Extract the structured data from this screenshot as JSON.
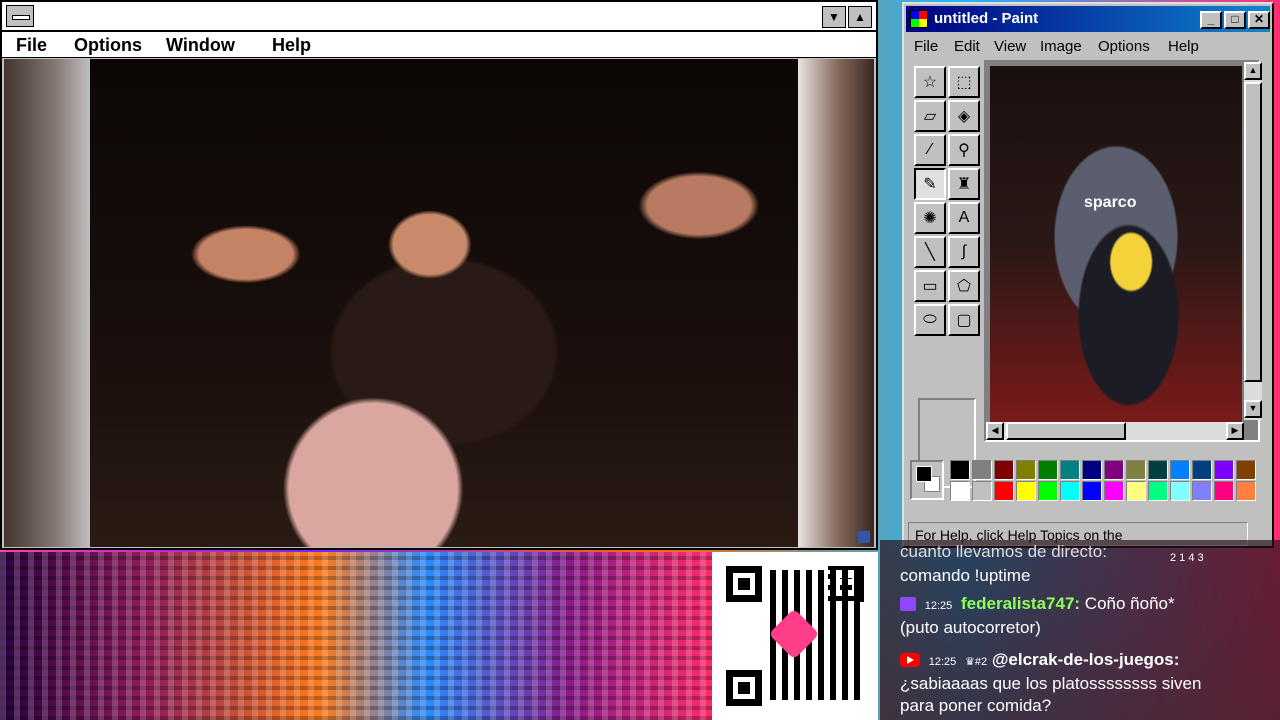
{
  "viewer": {
    "menu": [
      "File",
      "Options",
      "Window",
      "Help"
    ],
    "min_arrow": "▼",
    "max_arrow": "▲"
  },
  "paint": {
    "title": "untitled - Paint",
    "menu": [
      "File",
      "Edit",
      "View",
      "Image",
      "Options",
      "Help"
    ],
    "chair_label": "sparco",
    "status": "For Help, click Help Topics on the",
    "tools": [
      {
        "name": "free-select-icon",
        "glyph": "☆"
      },
      {
        "name": "rect-select-icon",
        "glyph": "⬚"
      },
      {
        "name": "eraser-icon",
        "glyph": "▱"
      },
      {
        "name": "fill-bucket-icon",
        "glyph": "◈"
      },
      {
        "name": "color-picker-icon",
        "glyph": "⁄"
      },
      {
        "name": "magnifier-icon",
        "glyph": "⚲"
      },
      {
        "name": "pencil-icon",
        "glyph": "✎"
      },
      {
        "name": "brush-icon",
        "glyph": "♜"
      },
      {
        "name": "airbrush-icon",
        "glyph": "✺"
      },
      {
        "name": "text-icon",
        "glyph": "A"
      },
      {
        "name": "line-icon",
        "glyph": "╲"
      },
      {
        "name": "curve-icon",
        "glyph": "∫"
      },
      {
        "name": "rectangle-icon",
        "glyph": "▭"
      },
      {
        "name": "polygon-icon",
        "glyph": "⬠"
      },
      {
        "name": "ellipse-icon",
        "glyph": "⬭"
      },
      {
        "name": "rounded-rect-icon",
        "glyph": "▢"
      }
    ],
    "palette_top": [
      "#000000",
      "#808080",
      "#800000",
      "#808000",
      "#008000",
      "#008080",
      "#000080",
      "#800080",
      "#808040",
      "#004040",
      "#0080ff",
      "#004080",
      "#8000ff",
      "#804000"
    ],
    "palette_bottom": [
      "#ffffff",
      "#c0c0c0",
      "#ff0000",
      "#ffff00",
      "#00ff00",
      "#00ffff",
      "#0000ff",
      "#ff00ff",
      "#ffff80",
      "#00ff80",
      "#80ffff",
      "#8080ff",
      "#ff0080",
      "#ff8040"
    ]
  },
  "chat": {
    "line1": "cuanto llevamos de directo:",
    "counts": "2  1  4  3",
    "line2": "comando !uptime",
    "msg1": {
      "time": "12:25",
      "user": "federalista747:",
      "text": " Coño ñoño*"
    },
    "msg1_cont": "(puto autocorretor)",
    "msg2": {
      "time": "12:25",
      "badge": "♛#2",
      "user": "@elcrak-de-los-juegos:"
    },
    "msg2_cont1": "¿sabiaaaas que los platossssssss siven",
    "msg2_cont2": "para poner comida?"
  }
}
